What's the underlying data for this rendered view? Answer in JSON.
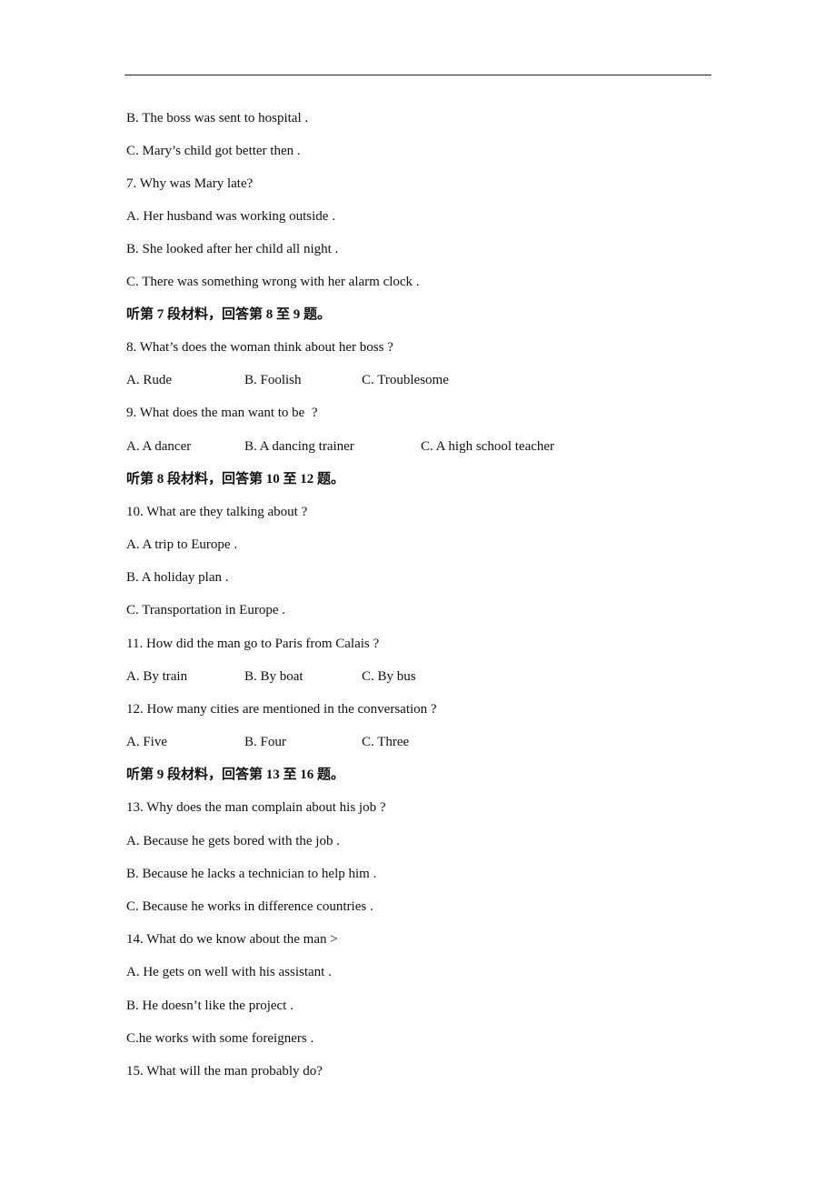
{
  "page": {
    "lines": [
      {
        "text": "B. The boss was sent to hospital ."
      },
      {
        "text": "C. Mary’s child got better then ."
      },
      {
        "text": "7. Why was Mary late?"
      },
      {
        "text": "A. Her husband was working outside ."
      },
      {
        "text": "B. She looked after her child all night ."
      },
      {
        "text": "C. There was something wrong with her alarm clock ."
      },
      {
        "text": "听第 7 段材料，回答第 8 至 9 题。"
      },
      {
        "text": "8. What’s does the woman think about her boss ?"
      },
      {
        "cols": [
          "A. Rude",
          "B. Foolish",
          "C. Troublesome"
        ]
      },
      {
        "text": "9. What does the man want to be  ?"
      },
      {
        "cols": [
          "A. A dancer",
          "B. A dancing trainer",
          "C. A high school teacher"
        ]
      },
      {
        "text": "听第 8 段材料，回答第 10 至 12 题。"
      },
      {
        "text": "10. What are they talking about ?"
      },
      {
        "text": "A. A trip to Europe ."
      },
      {
        "text": "B. A holiday plan ."
      },
      {
        "text": "C. Transportation in Europe ."
      },
      {
        "text": "11. How did the man go to Paris from Calais ?"
      },
      {
        "cols": [
          "A. By train",
          "B. By boat",
          "C. By bus"
        ]
      },
      {
        "text": "12. How many cities are mentioned in the conversation ?"
      },
      {
        "cols": [
          "A. Five",
          "B. Four",
          "C. Three"
        ]
      },
      {
        "text": "听第 9 段材料，回答第 13 至 16 题。"
      },
      {
        "text": "13. Why does the man complain about his job ?"
      },
      {
        "text": "A. Because he gets bored with the job ."
      },
      {
        "text": "B. Because he lacks a technician to help him ."
      },
      {
        "text": "C. Because he works in difference countries ."
      },
      {
        "text": "14. What do we know about the man >"
      },
      {
        "text": "A. He gets on well with his assistant ."
      },
      {
        "text": "B. He doesn’t like the project ."
      },
      {
        "text": "C.he works with some foreigners ."
      },
      {
        "text": "15. What will the man probably do?"
      }
    ]
  }
}
